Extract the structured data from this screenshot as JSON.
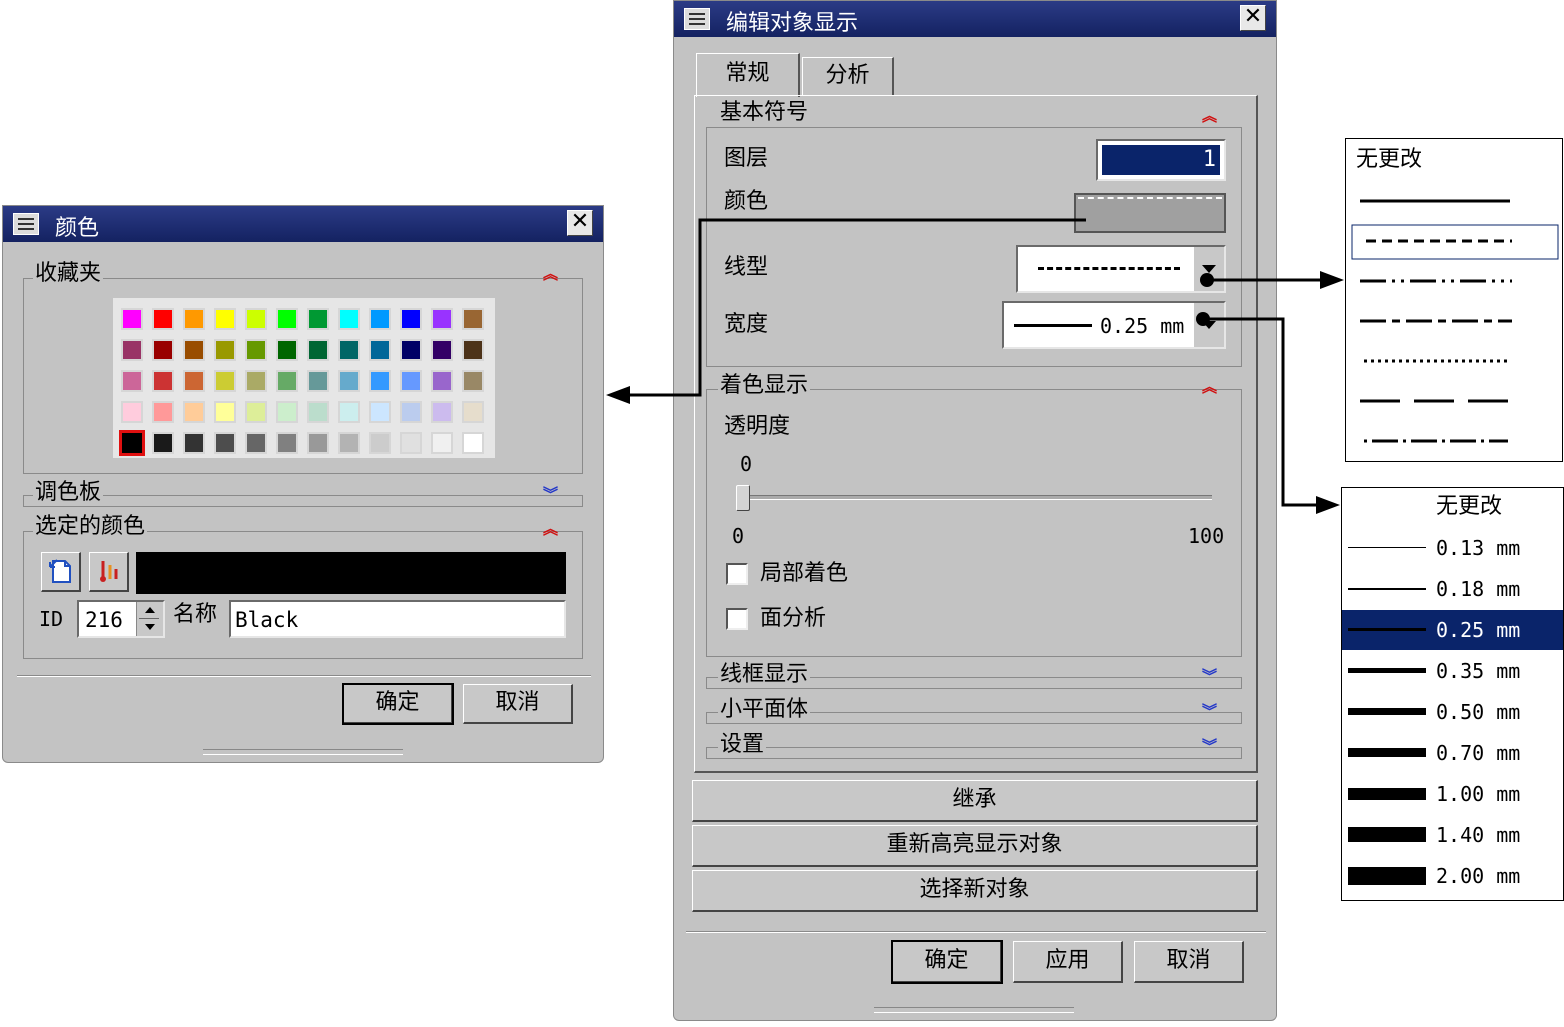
{
  "color_dialog": {
    "title": "颜色",
    "favorites_label": "收藏夹",
    "palette_label": "调色板",
    "selected_color_label": "选定的颜色",
    "id_label": "ID",
    "id_value": "216",
    "name_label": "名称",
    "name_value": "Black",
    "selected_color": "#000000",
    "ok": "确定",
    "cancel": "取消",
    "swatch_rows": [
      [
        "#ff00ff",
        "#ff0000",
        "#ff9900",
        "#ffff00",
        "#ccff00",
        "#00ff00",
        "#009933",
        "#00ffff",
        "#0099ff",
        "#0000ff",
        "#9933ff",
        "#996633"
      ],
      [
        "#993366",
        "#990000",
        "#994d00",
        "#999900",
        "#669900",
        "#006600",
        "#006633",
        "#006666",
        "#006699",
        "#000066",
        "#330066",
        "#4d3319"
      ],
      [
        "#cc6699",
        "#cc3333",
        "#cc6633",
        "#cccc33",
        "#aaaa66",
        "#66aa66",
        "#669999",
        "#66aacc",
        "#3399ff",
        "#6699ff",
        "#9966cc",
        "#998866"
      ],
      [
        "#ffccdd",
        "#ff9999",
        "#ffcc99",
        "#ffff99",
        "#ddee99",
        "#cceecc",
        "#bbddcc",
        "#cceeee",
        "#cce6ff",
        "#bbccee",
        "#ccbbee",
        "#e6ddcc"
      ],
      [
        "#000000",
        "#1a1a1a",
        "#333333",
        "#4d4d4d",
        "#666666",
        "#808080",
        "#999999",
        "#b3b3b3",
        "#cccccc",
        "#e0e0e0",
        "#f0f0f0",
        "#ffffff"
      ]
    ]
  },
  "main_dialog": {
    "title": "编辑对象显示",
    "tabs": [
      "常规",
      "分析"
    ],
    "basic_symbols_label": "基本符号",
    "layer_label": "图层",
    "layer_value": "1",
    "color_label": "颜色",
    "linetype_label": "线型",
    "width_label": "宽度",
    "width_value": "0.25 mm",
    "shading_label": "着色显示",
    "transparency_label": "透明度",
    "transparency_value": "0",
    "slider_min": "0",
    "slider_max": "100",
    "partial_shading_label": "局部着色",
    "face_analysis_label": "面分析",
    "wireframe_label": "线框显示",
    "facet_label": "小平面体",
    "settings_label": "设置",
    "inherit_button": "继承",
    "rehighlight_button": "重新高亮显示对象",
    "select_new_button": "选择新对象",
    "ok": "确定",
    "apply": "应用",
    "cancel": "取消"
  },
  "linetype_popup": {
    "no_change": "无更改",
    "items": [
      "solid",
      "dashed",
      "phantom",
      "center",
      "dotted",
      "long-dashed",
      "dash-dot"
    ]
  },
  "width_popup": {
    "no_change": "无更改",
    "items": [
      {
        "label": "0.13 mm",
        "thickness": 1
      },
      {
        "label": "0.18 mm",
        "thickness": 2
      },
      {
        "label": "0.25 mm",
        "thickness": 3
      },
      {
        "label": "0.35 mm",
        "thickness": 5
      },
      {
        "label": "0.50 mm",
        "thickness": 7
      },
      {
        "label": "0.70 mm",
        "thickness": 9
      },
      {
        "label": "1.00 mm",
        "thickness": 12
      },
      {
        "label": "1.40 mm",
        "thickness": 15
      },
      {
        "label": "2.00 mm",
        "thickness": 18
      }
    ],
    "selected_index": 2,
    "selected_color": "#0a246a"
  }
}
